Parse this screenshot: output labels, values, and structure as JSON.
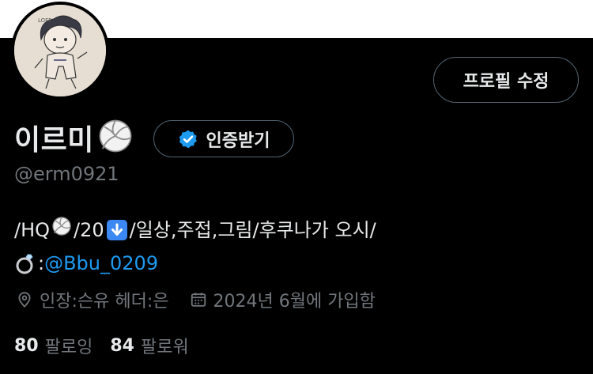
{
  "profile": {
    "display_name": "이르미",
    "handle": "@erm0921",
    "edit_button_label": "프로필 수정",
    "verify_button_label": "인증받기"
  },
  "bio": {
    "line1": {
      "prefix": "/HQ",
      "part2": "/20",
      "part3": "/일상,주접,그림/후쿠나가 오시/"
    },
    "line2": {
      "colon": ":",
      "mention": "@Bbu_0209"
    }
  },
  "meta": {
    "location": "인장:슨유 헤더:은",
    "joined": "2024년 6월에 가입함"
  },
  "stats": {
    "following_count": "80",
    "following_label": "팔로잉",
    "followers_count": "84",
    "followers_label": "팔로워"
  },
  "icons": {
    "name_emoji": "volleyball-icon",
    "bio_emoji_1": "volleyball-icon",
    "bio_emoji_2": "down-arrow-icon",
    "bio_emoji_3": "ring-icon",
    "verify_badge": "verified-badge-icon",
    "location": "location-pin-icon",
    "calendar": "calendar-icon"
  },
  "colors": {
    "background": "#000000",
    "banner": "#ffffff",
    "text": "#e7e9ea",
    "muted": "#71767b",
    "accent": "#1d9bf0",
    "border": "#536471"
  }
}
